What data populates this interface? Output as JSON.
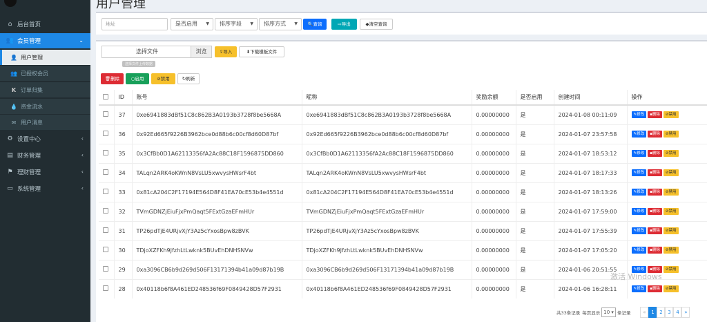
{
  "page_title": "用户管理",
  "sidebar": {
    "items": [
      {
        "label": "后台首页",
        "icon": "home-icon",
        "glyph": "⌂"
      },
      {
        "label": "会员管理",
        "icon": "users-icon",
        "glyph": "👥",
        "chev": "⌄"
      },
      {
        "label": "用户管理",
        "icon": "user-icon",
        "glyph": "👤"
      },
      {
        "label": "已授权会员",
        "icon": "users-icon",
        "glyph": "👥"
      },
      {
        "label": "订单归集",
        "icon": "k-icon",
        "glyph": "K"
      },
      {
        "label": "资金流水",
        "icon": "drop-icon",
        "glyph": "💧"
      },
      {
        "label": "用户消息",
        "icon": "envelope-icon",
        "glyph": "✉"
      },
      {
        "label": "设置中心",
        "icon": "cogs-icon",
        "glyph": "⚙",
        "chev": "‹"
      },
      {
        "label": "财务管理",
        "icon": "money-icon",
        "glyph": "▤",
        "chev": "‹"
      },
      {
        "label": "理财管理",
        "icon": "flag-icon",
        "glyph": "⚑",
        "chev": "‹"
      },
      {
        "label": "系统管理",
        "icon": "desktop-icon",
        "glyph": "▭",
        "chev": "‹"
      }
    ]
  },
  "search": {
    "address_placeholder": "地址",
    "enabled_select": "是否启用",
    "sort_field_select": "排序字段",
    "sort_order_select": "排序方式",
    "search_button": "查询",
    "export_button": "导出",
    "clear_button": "清空查询"
  },
  "import": {
    "file_text": "选择文件",
    "browse": "浏览",
    "import_button": "导入",
    "download_button": "下载模板文件",
    "tooltip": "选择文件上传数据"
  },
  "actions": {
    "delete": "删除",
    "enable": "启用",
    "disable": "禁用",
    "refresh": "刷新"
  },
  "table": {
    "headers": [
      "ID",
      "账号",
      "昵称",
      "奖励余额",
      "是否启用",
      "创建时间",
      "操作"
    ],
    "op_edit": "修改",
    "op_delete": "删除",
    "op_disable": "禁用",
    "rows": [
      {
        "id": "37",
        "account": "0xe6941883dBf51C8c862B3A0193b3728f8be5668A",
        "nickname": "0xe6941883dBf51C8c862B3A0193b3728f8be5668A",
        "balance": "0.00000000",
        "enabled": "是",
        "created": "2024-01-08 00:11:09"
      },
      {
        "id": "36",
        "account": "0x92Ed665f9226B3962bce0d88b6c00cf8d60D87bf",
        "nickname": "0x92Ed665f9226B3962bce0d88b6c00cf8d60D87bf",
        "balance": "0.00000000",
        "enabled": "是",
        "created": "2024-01-07 23:57:58"
      },
      {
        "id": "35",
        "account": "0x3CfBb0D1A62113356fA2Ac88C18F1596875DD860",
        "nickname": "0x3CfBb0D1A62113356fA2Ac88C18F1596875DD860",
        "balance": "0.00000000",
        "enabled": "是",
        "created": "2024-01-07 18:53:12"
      },
      {
        "id": "34",
        "account": "TALqn2ARK4oKWnN8VsLU5xwvysHWsrF4bt",
        "nickname": "TALqn2ARK4oKWnN8VsLU5xwvysHWsrF4bt",
        "balance": "0.00000000",
        "enabled": "是",
        "created": "2024-01-07 18:17:33"
      },
      {
        "id": "33",
        "account": "0x81cA204C2F17194E564D8F41EA70cE53b4e4551d",
        "nickname": "0x81cA204C2F17194E564D8F41EA70cE53b4e4551d",
        "balance": "0.00000000",
        "enabled": "是",
        "created": "2024-01-07 18:13:26"
      },
      {
        "id": "32",
        "account": "TVmGDNZjEiuFjxPmQaqt5FExtGzaEFmHUr",
        "nickname": "TVmGDNZjEiuFjxPmQaqt5FExtGzaEFmHUr",
        "balance": "0.00000000",
        "enabled": "是",
        "created": "2024-01-07 17:59:00"
      },
      {
        "id": "31",
        "account": "TP26pdTjE4URjvXjY3Az5cYxosBpw8zBVK",
        "nickname": "TP26pdTjE4URjvXjY3Az5cYxosBpw8zBVK",
        "balance": "0.00000000",
        "enabled": "是",
        "created": "2024-01-07 17:55:39"
      },
      {
        "id": "30",
        "account": "TDjoXZFKh9JfzhLtLwknk5BUvEhDNHSNVw",
        "nickname": "TDjoXZFKh9JfzhLtLwknk5BUvEhDNHSNVw",
        "balance": "0.00000000",
        "enabled": "是",
        "created": "2024-01-07 17:05:20"
      },
      {
        "id": "29",
        "account": "0xa3096CB6b9d269d506F13171394b41a09d87b19B",
        "nickname": "0xa3096CB6b9d269d506F13171394b41a09d87b19B",
        "balance": "0.00000000",
        "enabled": "是",
        "created": "2024-01-06 20:51:55"
      },
      {
        "id": "28",
        "account": "0x40118b6f8A461ED248536f69F0849428D57F2931",
        "nickname": "0x40118b6f8A461ED248536f69F0849428D57F2931",
        "balance": "0.00000000",
        "enabled": "是",
        "created": "2024-01-06 16:28:11"
      }
    ]
  },
  "pagination": {
    "total_text": "共33条记录",
    "per_page_label": "每页显示",
    "per_page_value": "10",
    "per_page_suffix": "条记录",
    "prev": "«",
    "pages": [
      "1",
      "2",
      "3",
      "4"
    ],
    "next": "»"
  },
  "watermark": "激活 Windows",
  "colors": {
    "sidebar_bg": "#222d32",
    "active_blue": "#1e88e5",
    "delete_red": "#dd2c34",
    "enable_green": "#18a05a",
    "disable_yellow": "#f6c02b"
  }
}
